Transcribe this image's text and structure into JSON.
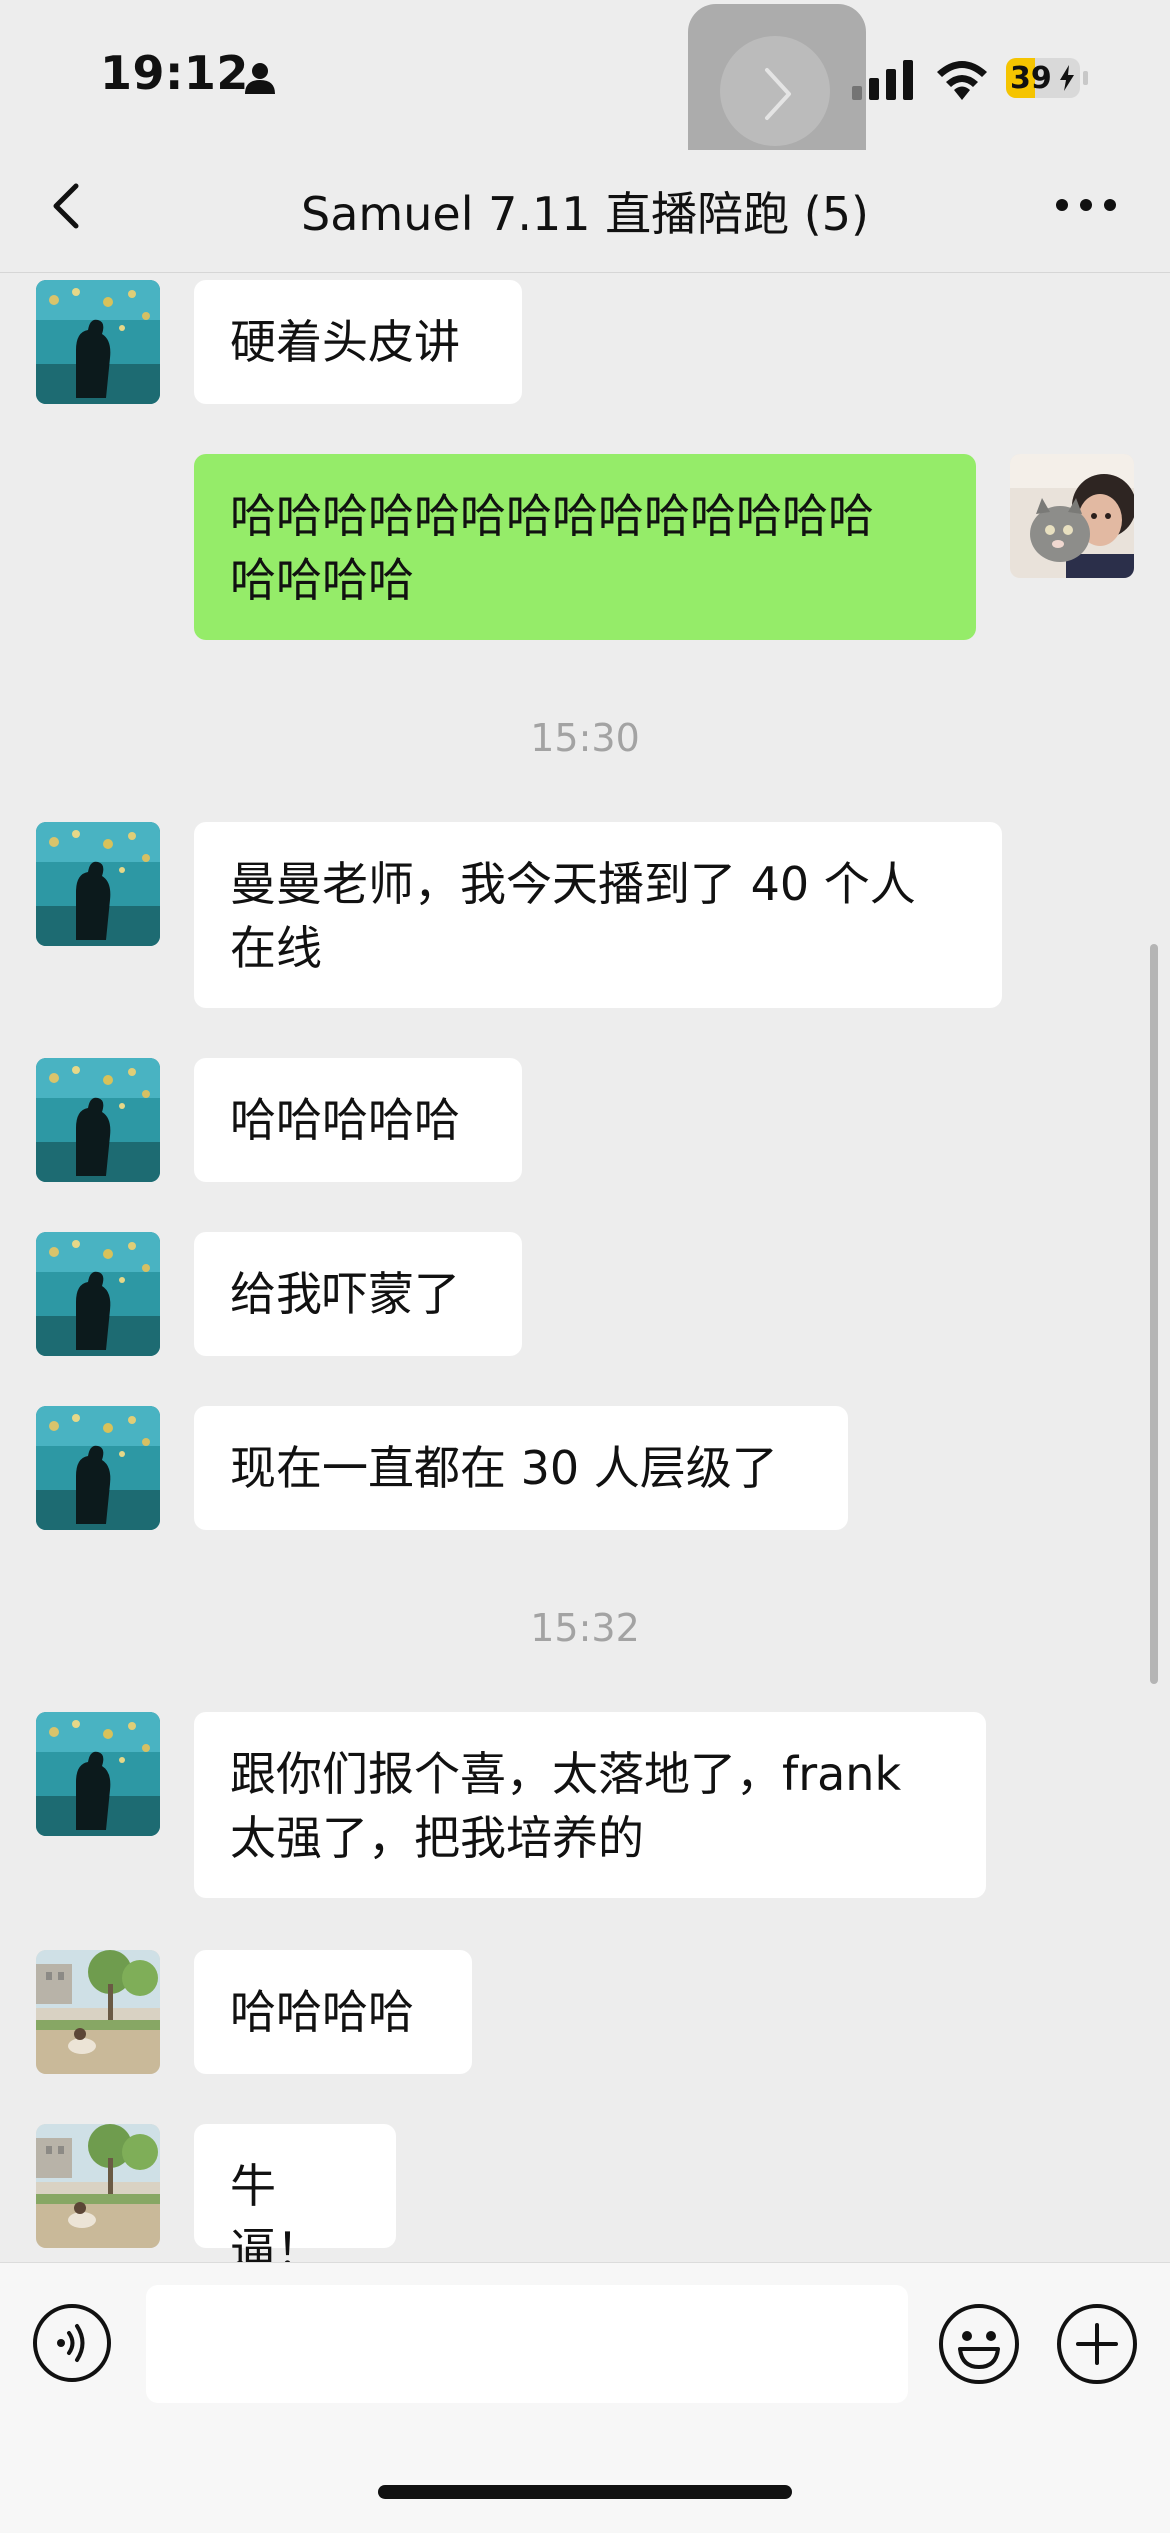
{
  "status_bar": {
    "time": "19:12",
    "battery_percent": "39",
    "battery_level": 0.39,
    "icons": [
      "person-icon",
      "signal-icon",
      "wifi-icon",
      "battery-charging-icon"
    ]
  },
  "nav": {
    "title": "Samuel 7.11 直播陪跑 (5)",
    "back_icon": "chevron-left-icon",
    "more_icon": "more-dots-icon"
  },
  "messages": [
    {
      "side": "in",
      "sender_avatar": "aquarium-avatar",
      "text": "硬着头皮讲"
    },
    {
      "side": "out",
      "sender_avatar": "cat-girl-avatar",
      "text_line1": "哈哈哈哈哈哈哈哈哈哈哈哈哈哈",
      "text_line2": "哈哈哈哈"
    },
    {
      "timestamp": "15:30"
    },
    {
      "side": "in",
      "sender_avatar": "aquarium-avatar",
      "text_line1": "曼曼老师，我今天播到了 40 个人",
      "text_line2": "在线"
    },
    {
      "side": "in",
      "sender_avatar": "aquarium-avatar",
      "text": "哈哈哈哈哈"
    },
    {
      "side": "in",
      "sender_avatar": "aquarium-avatar",
      "text": "给我吓蒙了"
    },
    {
      "side": "in",
      "sender_avatar": "aquarium-avatar",
      "text": "现在一直都在 30 人层级了"
    },
    {
      "timestamp": "15:32"
    },
    {
      "side": "in",
      "sender_avatar": "aquarium-avatar",
      "text_line1": "跟你们报个喜，太落地了，frank",
      "text_line2": "太强了，把我培养的"
    },
    {
      "side": "in",
      "sender_avatar": "park-avatar",
      "text": "哈哈哈哈"
    },
    {
      "side": "in",
      "sender_avatar": "park-avatar",
      "text": "牛逼！"
    }
  ],
  "input_bar": {
    "voice_icon": "voice-icon",
    "emoji_icon": "emoji-icon",
    "plus_icon": "plus-icon",
    "input_value": ""
  },
  "colors": {
    "background": "#ededed",
    "incoming_bubble": "#ffffff",
    "outgoing_bubble": "#95ec69",
    "timestamp_text": "#a3a3a3",
    "battery_fill": "#f5c400"
  }
}
